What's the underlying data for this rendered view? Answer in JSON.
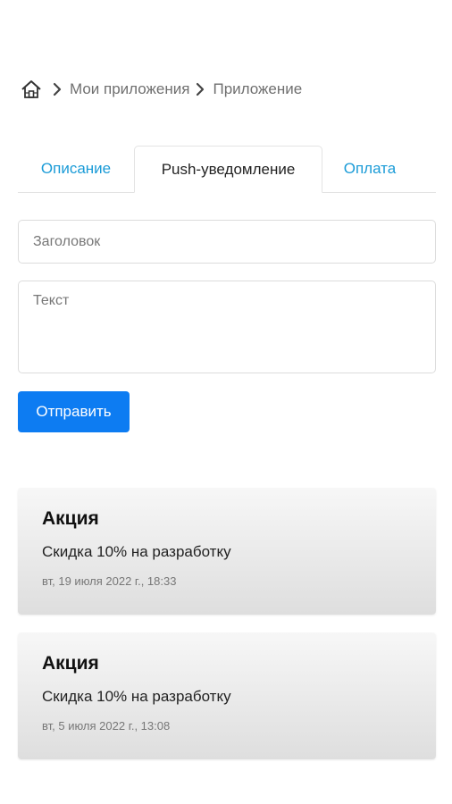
{
  "breadcrumb": {
    "home_icon": "home-icon",
    "separator_icon": "chevron-right-icon",
    "items": [
      "Мои приложения",
      "Приложение"
    ]
  },
  "tabs": [
    {
      "label": "Описание",
      "active": false
    },
    {
      "label": "Push-уведомление",
      "active": true
    },
    {
      "label": "Оплата",
      "active": false
    }
  ],
  "form": {
    "title_placeholder": "Заголовок",
    "title_value": "",
    "text_placeholder": "Текст",
    "text_value": "",
    "send_label": "Отправить"
  },
  "notifications": [
    {
      "title": "Акция",
      "text": "Скидка 10% на разработку",
      "date": "вт, 19 июля 2022 г., 18:33"
    },
    {
      "title": "Акция",
      "text": "Скидка 10% на разработку",
      "date": "вт, 5 июля 2022 г., 13:08"
    }
  ],
  "colors": {
    "accent": "#0d7cf2",
    "link": "#1a9bd7",
    "card_top": "#f7f7f7",
    "card_bottom": "#dedede"
  }
}
